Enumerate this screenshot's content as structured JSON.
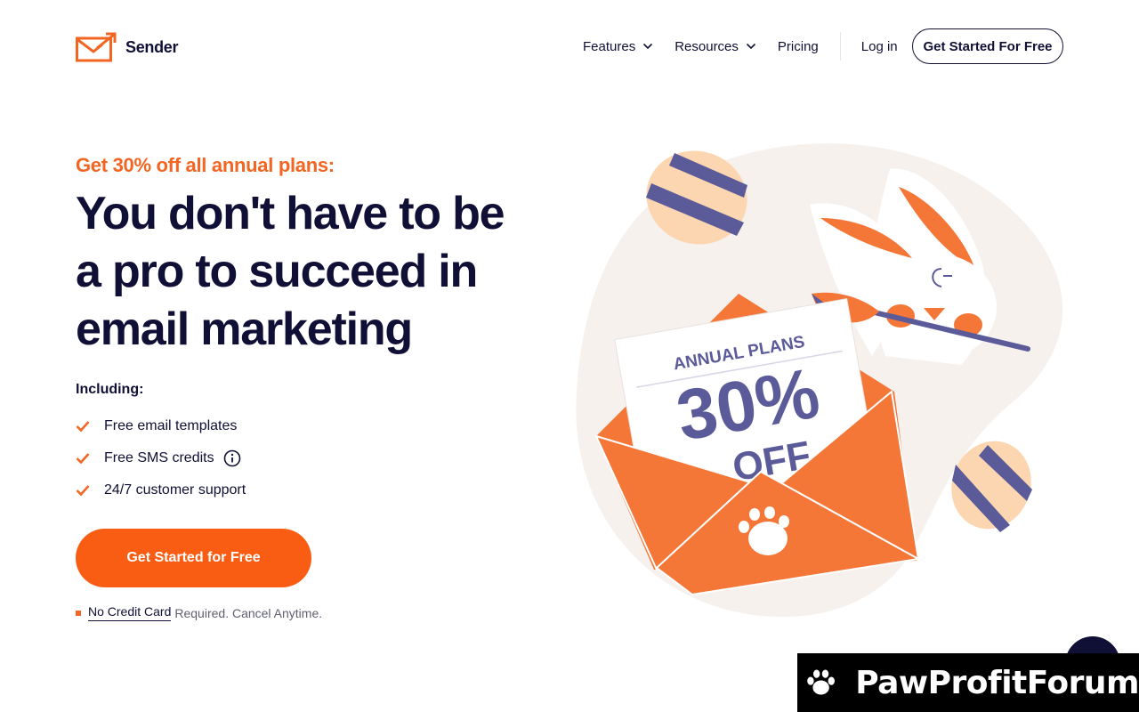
{
  "header": {
    "brand": "Sender",
    "nav": {
      "features": "Features",
      "resources": "Resources",
      "pricing": "Pricing",
      "login": "Log in"
    },
    "cta_label": "Get Started For Free"
  },
  "hero": {
    "promo": "Get 30% off all annual plans:",
    "headline": "You don't have to be a pro to succeed in email marketing",
    "including_label": "Including:",
    "features": [
      "Free email templates",
      "Free SMS credits",
      "24/7 customer support"
    ],
    "cta_label": "Get Started for Free",
    "note_link": "No Credit Card",
    "note_rest": "Required. Cancel Anytime."
  },
  "illustration": {
    "card_title": "ANNUAL PLANS",
    "card_value": "30%",
    "card_off": "OFF"
  },
  "watermark": {
    "text": "PawProfitForum"
  },
  "colors": {
    "accent": "#f26522",
    "cta": "#f95d14",
    "navy": "#101036",
    "purple": "#5b5b9a",
    "peach": "#fcd6b0"
  }
}
